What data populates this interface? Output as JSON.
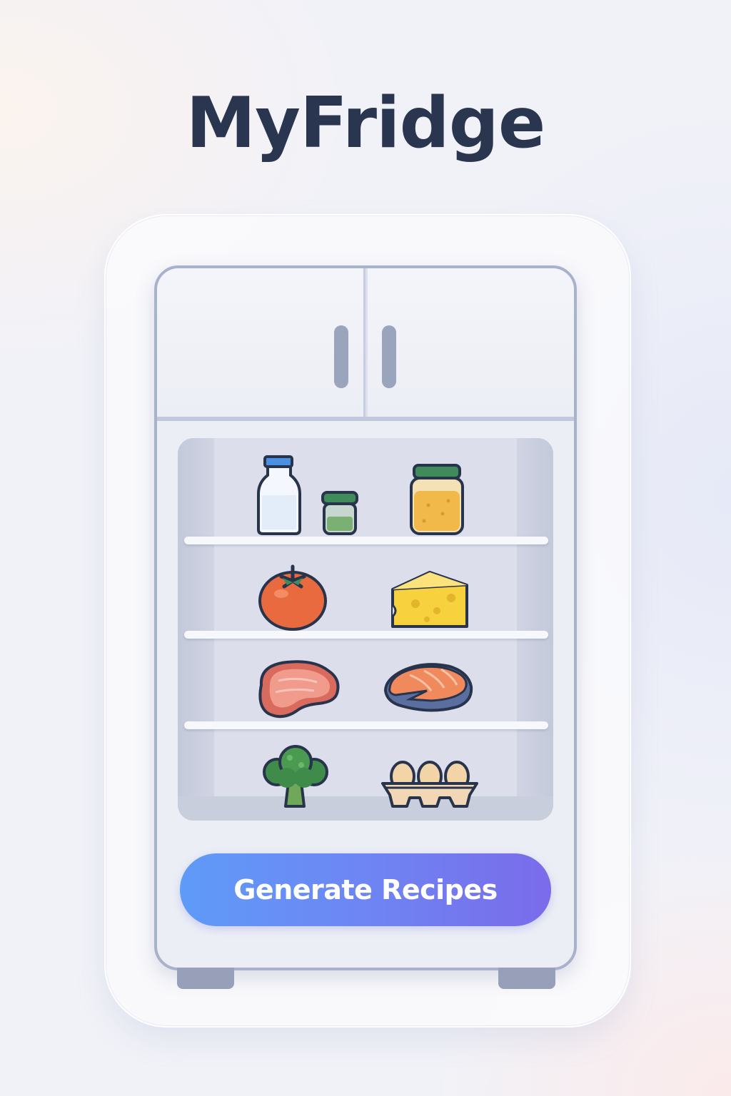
{
  "app": {
    "title": "MyFridge"
  },
  "fridge": {
    "shelves": [
      {
        "items": [
          "milk-bottle-icon",
          "small-jar-icon",
          "honey-jar-icon"
        ]
      },
      {
        "items": [
          "tomato-icon",
          "cheese-icon"
        ]
      },
      {
        "items": [
          "steak-icon",
          "salmon-icon"
        ]
      },
      {
        "items": [
          "broccoli-icon",
          "eggs-carton-icon"
        ]
      }
    ]
  },
  "actions": {
    "generate_label": "Generate Recipes"
  },
  "colors": {
    "title": "#2a3650",
    "button_start": "#5f9bf8",
    "button_end": "#7a6bea",
    "fridge_outline": "#a9b2cb"
  }
}
